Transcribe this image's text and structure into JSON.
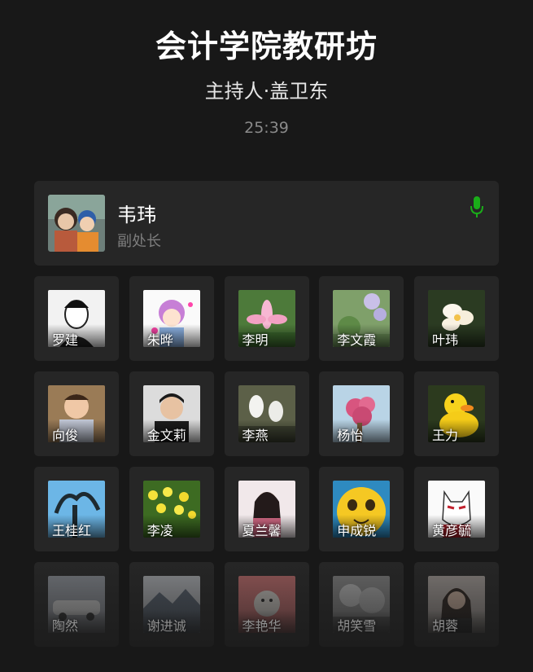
{
  "meeting": {
    "title": "会计学院教研坊",
    "host": "主持人·盖卫东",
    "timer": "25:39"
  },
  "speaker": {
    "name": "韦玮",
    "role": "副处长",
    "mic_icon": "mic-icon",
    "mic_color": "#1aad19"
  },
  "participants": [
    {
      "name": "罗建"
    },
    {
      "name": "朱晔"
    },
    {
      "name": "李明"
    },
    {
      "name": "李文霞"
    },
    {
      "name": "叶玮"
    },
    {
      "name": "向俊"
    },
    {
      "name": "金文莉"
    },
    {
      "name": "李燕"
    },
    {
      "name": "杨怡"
    },
    {
      "name": "王力"
    },
    {
      "name": "王桂红"
    },
    {
      "name": "李凌"
    },
    {
      "name": "夏兰馨"
    },
    {
      "name": "申成锐"
    },
    {
      "name": "黄彦毓"
    },
    {
      "name": "陶然"
    },
    {
      "name": "谢进诚"
    },
    {
      "name": "李艳华"
    },
    {
      "name": "胡笑雪"
    },
    {
      "name": "胡蓉"
    }
  ]
}
